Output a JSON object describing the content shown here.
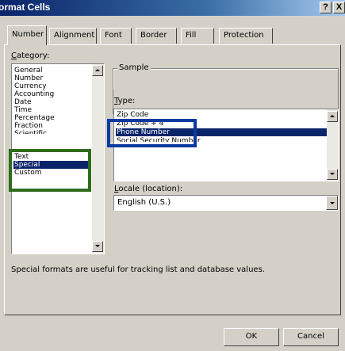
{
  "window": {
    "title": "ormat Cells",
    "help_label": "?",
    "close_label": "X"
  },
  "tabs": [
    {
      "label": "Number",
      "active": true
    },
    {
      "label": "Alignment",
      "active": false
    },
    {
      "label": "Font",
      "active": false
    },
    {
      "label": "Border",
      "active": false
    },
    {
      "label": "Fill",
      "active": false
    },
    {
      "label": "Protection",
      "active": false
    }
  ],
  "category": {
    "label": "Category:",
    "label_underline": "C",
    "label_rest": "ategory:",
    "items": [
      "General",
      "Number",
      "Currency",
      "Accounting",
      "Date",
      "Time",
      "Percentage",
      "Fraction",
      "Scientific",
      "Text",
      "Special",
      "Custom"
    ],
    "selected": "Special"
  },
  "sample": {
    "label": "Sample"
  },
  "type": {
    "label": "Type:",
    "label_underline": "T",
    "label_rest": "ype:",
    "items": [
      "Zip Code",
      "Zip Code + 4",
      "Phone Number",
      "Social Security Number"
    ],
    "selected": "Phone Number"
  },
  "locale": {
    "label": "Locale (location):",
    "label_underline": "L",
    "label_rest": "ocale (location):",
    "value": "English (U.S.)"
  },
  "description": "Special formats are useful for tracking list and database values.",
  "buttons": {
    "ok_label": "OK",
    "cancel_label": "Cancel"
  },
  "colors": {
    "dialog_face": "#d4d0c8",
    "selection": "#0a246a",
    "highlight_green": "#2e6b1a",
    "highlight_blue": "#0a3aa0"
  }
}
